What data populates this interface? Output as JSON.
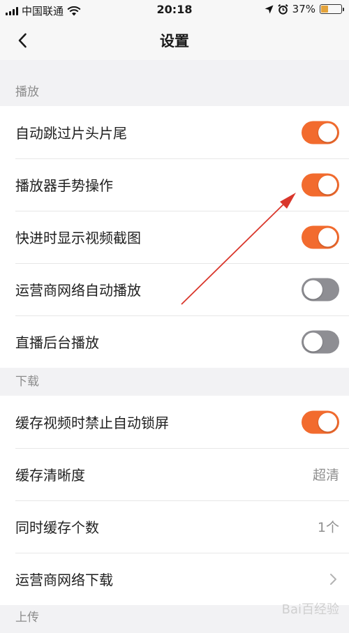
{
  "status_bar": {
    "carrier": "中国联通",
    "time": "20:18",
    "battery": "37%",
    "battery_level": 0.37,
    "icons": [
      "signal-icon",
      "wifi-icon",
      "location-icon",
      "alarm-icon",
      "battery-icon"
    ]
  },
  "nav": {
    "title": "设置",
    "back_icon": "chevron-left-icon"
  },
  "sections": {
    "playback": {
      "header": "播放",
      "items": [
        {
          "label": "自动跳过片头片尾",
          "toggle": "on"
        },
        {
          "label": "播放器手势操作",
          "toggle": "on"
        },
        {
          "label": "快进时显示视频截图",
          "toggle": "on"
        },
        {
          "label": "运营商网络自动播放",
          "toggle": "off"
        },
        {
          "label": "直播后台播放",
          "toggle": "off"
        }
      ]
    },
    "download": {
      "header": "下载",
      "items": [
        {
          "label": "缓存视频时禁止自动锁屏",
          "toggle": "on"
        },
        {
          "label": "缓存清晰度",
          "value": "超清"
        },
        {
          "label": "同时缓存个数",
          "value": "1个"
        },
        {
          "label": "运营商网络下载",
          "icon": "chevron-right-icon"
        }
      ]
    },
    "upload": {
      "header": "上传"
    }
  },
  "colors": {
    "toggle_on": "#f26b2e",
    "toggle_off": "#8e8e93",
    "annotation_arrow": "#d9362b"
  },
  "watermark": "Bai百经验"
}
